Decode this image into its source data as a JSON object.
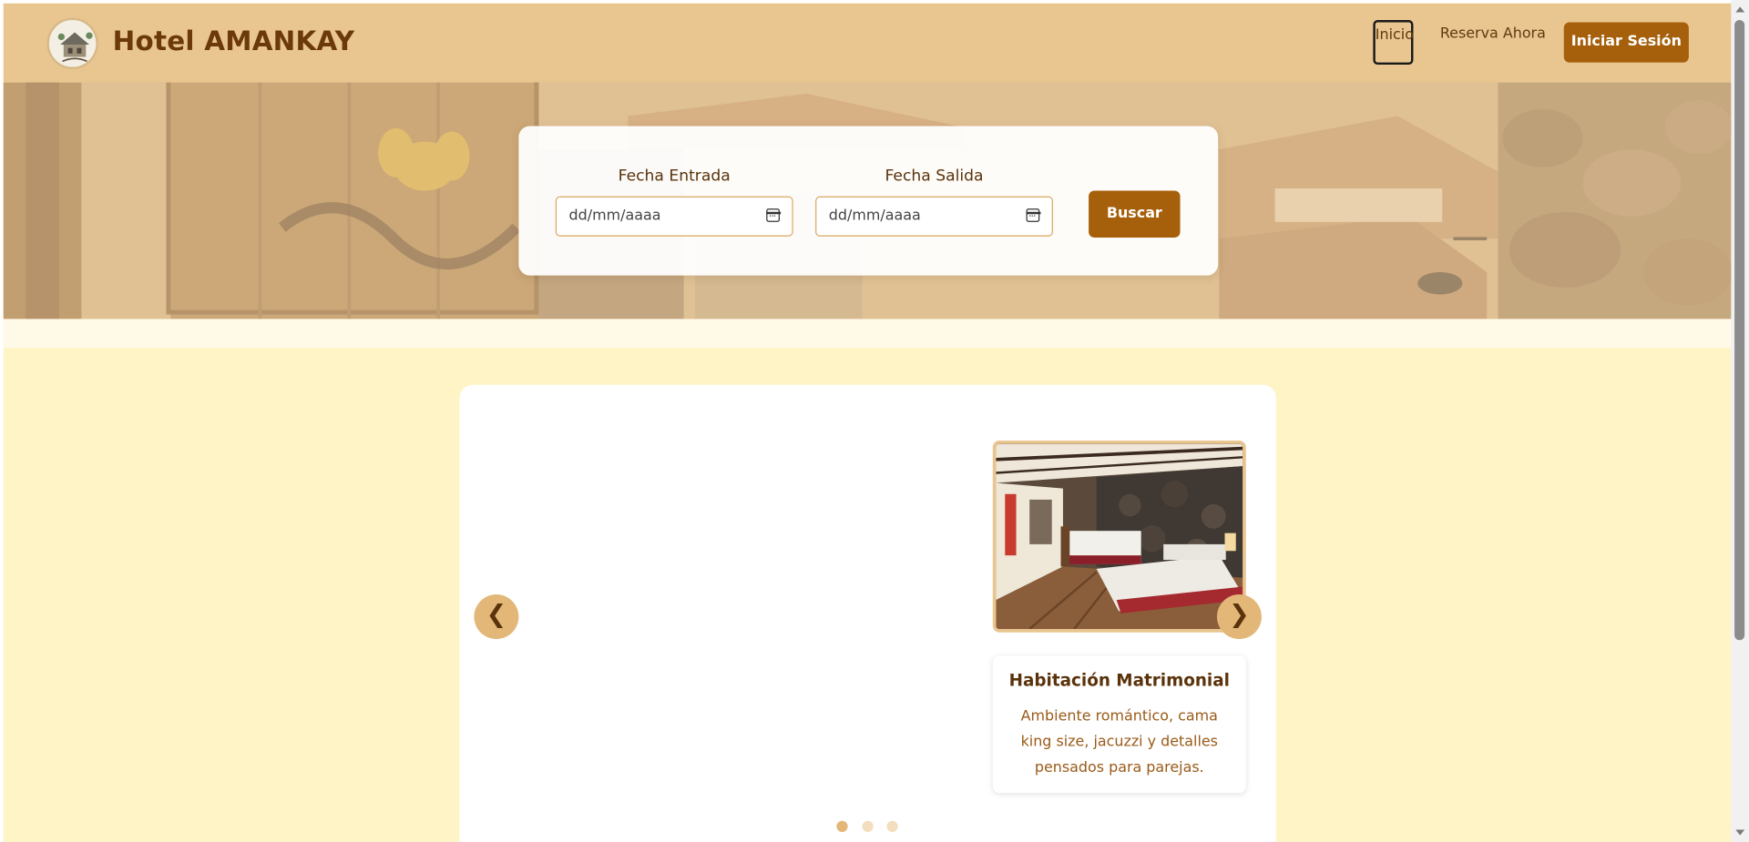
{
  "header": {
    "brand_title": "Hotel AMANKAY",
    "nav": {
      "inicio": "Inicio",
      "reserva": "Reserva Ahora"
    },
    "login_label": "Iniciar Sesión"
  },
  "search": {
    "entrada_label": "Fecha Entrada",
    "salida_label": "Fecha Salida",
    "entrada_placeholder": "dd/mm/aaaa",
    "salida_placeholder": "dd/mm/aaaa",
    "button_label": "Buscar"
  },
  "carousel": {
    "prev_symbol": "❮",
    "next_symbol": "❯",
    "room": {
      "title": "Habitación Matrimonial",
      "description": "Ambiente romántico, cama king size, jacuzzi y detalles pensados para parejas."
    },
    "active_slide": 1,
    "slide_count": 3
  },
  "colors": {
    "header_bg": "#e9c590",
    "brand": "#6c3a0a",
    "primary_button": "#a65f0a",
    "page_bg": "#fff4c6"
  }
}
